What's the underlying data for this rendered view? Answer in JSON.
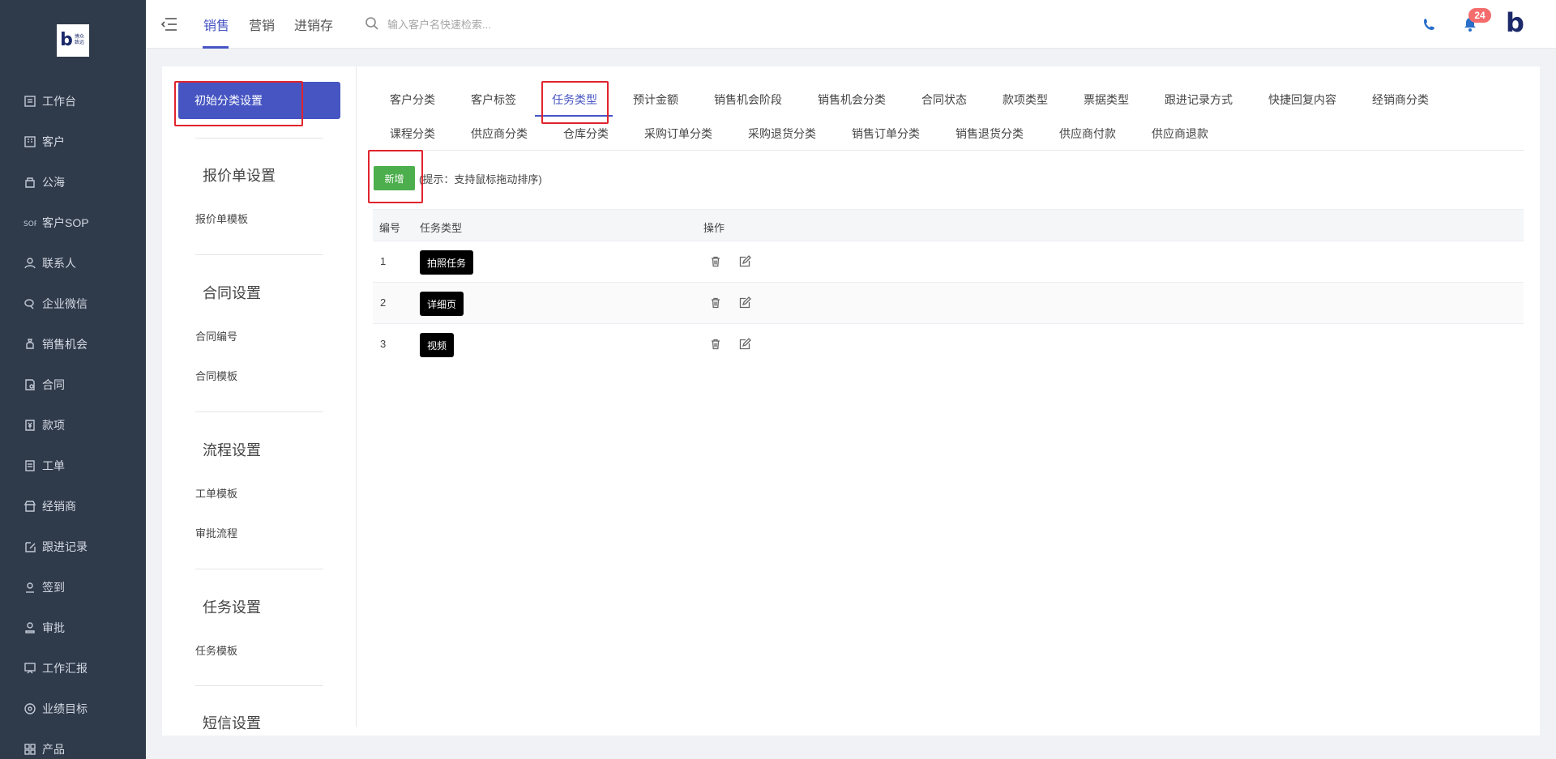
{
  "brand": {
    "logo_text": "博众\n致远"
  },
  "sidebar": {
    "items": [
      {
        "label": "工作台",
        "icon": "dashboard-icon"
      },
      {
        "label": "客户",
        "icon": "building-icon"
      },
      {
        "label": "公海",
        "icon": "pool-icon"
      },
      {
        "label": "客户SOP",
        "icon": "sop-icon"
      },
      {
        "label": "联系人",
        "icon": "user-icon"
      },
      {
        "label": "企业微信",
        "icon": "wechat-icon"
      },
      {
        "label": "销售机会",
        "icon": "money-bag-icon"
      },
      {
        "label": "合同",
        "icon": "contract-icon"
      },
      {
        "label": "款项",
        "icon": "payment-icon"
      },
      {
        "label": "工单",
        "icon": "ticket-icon"
      },
      {
        "label": "经销商",
        "icon": "store-icon"
      },
      {
        "label": "跟进记录",
        "icon": "edit-icon"
      },
      {
        "label": "签到",
        "icon": "location-icon"
      },
      {
        "label": "审批",
        "icon": "stamp-icon"
      },
      {
        "label": "工作汇报",
        "icon": "report-icon"
      },
      {
        "label": "业绩目标",
        "icon": "target-icon"
      },
      {
        "label": "产品",
        "icon": "grid-icon"
      }
    ]
  },
  "topbar": {
    "tabs": [
      "销售",
      "营销",
      "进销存"
    ],
    "active_tab": "销售",
    "search_placeholder": "输入客户名快速检索...",
    "notification_count": "24",
    "brand_letter": "b"
  },
  "settings": {
    "active_item": "初始分类设置",
    "sections": [
      {
        "title": "报价单设置",
        "links": [
          "报价单模板"
        ]
      },
      {
        "title": "合同设置",
        "links": [
          "合同编号",
          "合同模板"
        ]
      },
      {
        "title": "流程设置",
        "links": [
          "工单模板",
          "审批流程"
        ]
      },
      {
        "title": "任务设置",
        "links": [
          "任务模板"
        ]
      },
      {
        "title": "短信设置",
        "links": []
      }
    ]
  },
  "content": {
    "tabs_row1": [
      "客户分类",
      "客户标签",
      "任务类型",
      "预计金额",
      "销售机会阶段",
      "销售机会分类",
      "合同状态",
      "款项类型",
      "票据类型",
      "跟进记录方式",
      "快捷回复内容",
      "经销商分类"
    ],
    "tabs_row2": [
      "课程分类",
      "供应商分类",
      "仓库分类",
      "采购订单分类",
      "采购退货分类",
      "销售订单分类",
      "销售退货分类",
      "供应商付款",
      "供应商退款"
    ],
    "active_tab": "任务类型",
    "add_button": "新增",
    "hint": "(提示：支持鼠标拖动排序)",
    "table": {
      "headers": [
        "编号",
        "任务类型",
        "操作"
      ],
      "rows": [
        {
          "num": "1",
          "type": "拍照任务"
        },
        {
          "num": "2",
          "type": "详细页"
        },
        {
          "num": "3",
          "type": "视频"
        }
      ]
    }
  },
  "colors": {
    "sidebar_bg": "#2f3a4b",
    "accent": "#4655c2",
    "add_button": "#4cae4c",
    "badge": "#f56c6c",
    "annotation_red": "#e0242d"
  }
}
